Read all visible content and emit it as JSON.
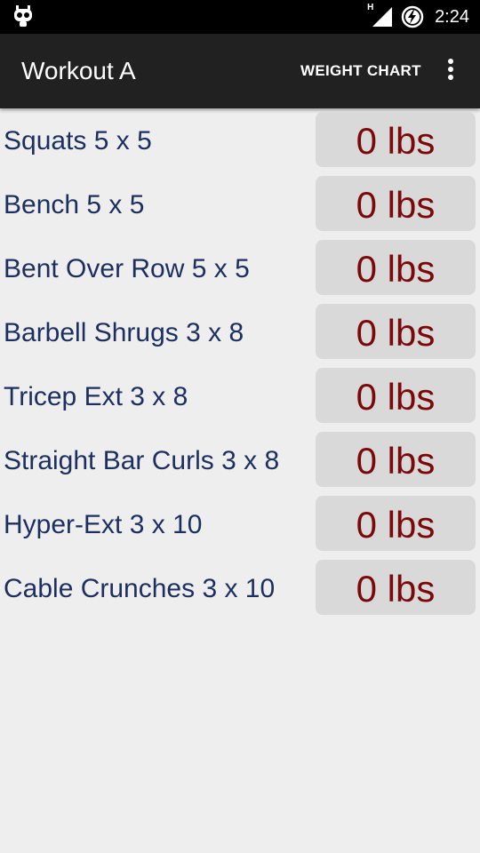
{
  "status_bar": {
    "time": "2:24",
    "network_label": "H",
    "icons": [
      "debug-bug-icon",
      "signal-icon",
      "battery-charging-icon"
    ]
  },
  "app_bar": {
    "title": "Workout A",
    "action_label": "WEIGHT CHART",
    "overflow_icon": "more-vert-icon"
  },
  "exercises": [
    {
      "label": "Squats 5 x 5",
      "weight": "0 lbs"
    },
    {
      "label": "Bench 5 x 5",
      "weight": "0 lbs"
    },
    {
      "label": "Bent Over Row 5 x 5",
      "weight": "0 lbs"
    },
    {
      "label": "Barbell Shrugs 3 x 8",
      "weight": "0 lbs"
    },
    {
      "label": "Tricep Ext 3 x 8",
      "weight": "0 lbs"
    },
    {
      "label": "Straight Bar Curls 3 x 8",
      "weight": "0 lbs"
    },
    {
      "label": "Hyper-Ext 3 x 10",
      "weight": "0 lbs"
    },
    {
      "label": "Cable Crunches 3 x 10",
      "weight": "0 lbs"
    }
  ],
  "colors": {
    "label_text": "#1c2f5e",
    "weight_text": "#7a0a0a",
    "button_bg": "#d9d9d9",
    "app_bar_bg": "#212121",
    "status_bar_bg": "#000000",
    "page_bg": "#eeeeee"
  }
}
